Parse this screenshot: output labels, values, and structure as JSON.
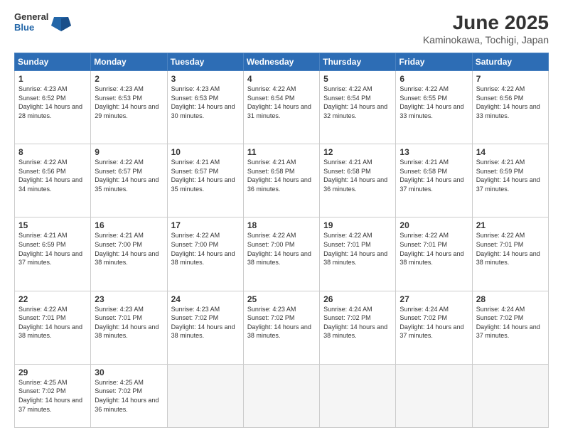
{
  "header": {
    "logo": {
      "line1": "General",
      "line2": "Blue"
    },
    "title": "June 2025",
    "location": "Kaminokawa, Tochigi, Japan"
  },
  "days_of_week": [
    "Sunday",
    "Monday",
    "Tuesday",
    "Wednesday",
    "Thursday",
    "Friday",
    "Saturday"
  ],
  "weeks": [
    [
      {
        "day": "1",
        "sunrise": "4:23 AM",
        "sunset": "6:52 PM",
        "daylight": "14 hours and 28 minutes."
      },
      {
        "day": "2",
        "sunrise": "4:23 AM",
        "sunset": "6:53 PM",
        "daylight": "14 hours and 29 minutes."
      },
      {
        "day": "3",
        "sunrise": "4:23 AM",
        "sunset": "6:53 PM",
        "daylight": "14 hours and 30 minutes."
      },
      {
        "day": "4",
        "sunrise": "4:22 AM",
        "sunset": "6:54 PM",
        "daylight": "14 hours and 31 minutes."
      },
      {
        "day": "5",
        "sunrise": "4:22 AM",
        "sunset": "6:54 PM",
        "daylight": "14 hours and 32 minutes."
      },
      {
        "day": "6",
        "sunrise": "4:22 AM",
        "sunset": "6:55 PM",
        "daylight": "14 hours and 33 minutes."
      },
      {
        "day": "7",
        "sunrise": "4:22 AM",
        "sunset": "6:56 PM",
        "daylight": "14 hours and 33 minutes."
      }
    ],
    [
      {
        "day": "8",
        "sunrise": "4:22 AM",
        "sunset": "6:56 PM",
        "daylight": "14 hours and 34 minutes."
      },
      {
        "day": "9",
        "sunrise": "4:22 AM",
        "sunset": "6:57 PM",
        "daylight": "14 hours and 35 minutes."
      },
      {
        "day": "10",
        "sunrise": "4:21 AM",
        "sunset": "6:57 PM",
        "daylight": "14 hours and 35 minutes."
      },
      {
        "day": "11",
        "sunrise": "4:21 AM",
        "sunset": "6:58 PM",
        "daylight": "14 hours and 36 minutes."
      },
      {
        "day": "12",
        "sunrise": "4:21 AM",
        "sunset": "6:58 PM",
        "daylight": "14 hours and 36 minutes."
      },
      {
        "day": "13",
        "sunrise": "4:21 AM",
        "sunset": "6:58 PM",
        "daylight": "14 hours and 37 minutes."
      },
      {
        "day": "14",
        "sunrise": "4:21 AM",
        "sunset": "6:59 PM",
        "daylight": "14 hours and 37 minutes."
      }
    ],
    [
      {
        "day": "15",
        "sunrise": "4:21 AM",
        "sunset": "6:59 PM",
        "daylight": "14 hours and 37 minutes."
      },
      {
        "day": "16",
        "sunrise": "4:21 AM",
        "sunset": "7:00 PM",
        "daylight": "14 hours and 38 minutes."
      },
      {
        "day": "17",
        "sunrise": "4:22 AM",
        "sunset": "7:00 PM",
        "daylight": "14 hours and 38 minutes."
      },
      {
        "day": "18",
        "sunrise": "4:22 AM",
        "sunset": "7:00 PM",
        "daylight": "14 hours and 38 minutes."
      },
      {
        "day": "19",
        "sunrise": "4:22 AM",
        "sunset": "7:01 PM",
        "daylight": "14 hours and 38 minutes."
      },
      {
        "day": "20",
        "sunrise": "4:22 AM",
        "sunset": "7:01 PM",
        "daylight": "14 hours and 38 minutes."
      },
      {
        "day": "21",
        "sunrise": "4:22 AM",
        "sunset": "7:01 PM",
        "daylight": "14 hours and 38 minutes."
      }
    ],
    [
      {
        "day": "22",
        "sunrise": "4:22 AM",
        "sunset": "7:01 PM",
        "daylight": "14 hours and 38 minutes."
      },
      {
        "day": "23",
        "sunrise": "4:23 AM",
        "sunset": "7:01 PM",
        "daylight": "14 hours and 38 minutes."
      },
      {
        "day": "24",
        "sunrise": "4:23 AM",
        "sunset": "7:02 PM",
        "daylight": "14 hours and 38 minutes."
      },
      {
        "day": "25",
        "sunrise": "4:23 AM",
        "sunset": "7:02 PM",
        "daylight": "14 hours and 38 minutes."
      },
      {
        "day": "26",
        "sunrise": "4:24 AM",
        "sunset": "7:02 PM",
        "daylight": "14 hours and 38 minutes."
      },
      {
        "day": "27",
        "sunrise": "4:24 AM",
        "sunset": "7:02 PM",
        "daylight": "14 hours and 37 minutes."
      },
      {
        "day": "28",
        "sunrise": "4:24 AM",
        "sunset": "7:02 PM",
        "daylight": "14 hours and 37 minutes."
      }
    ],
    [
      {
        "day": "29",
        "sunrise": "4:25 AM",
        "sunset": "7:02 PM",
        "daylight": "14 hours and 37 minutes."
      },
      {
        "day": "30",
        "sunrise": "4:25 AM",
        "sunset": "7:02 PM",
        "daylight": "14 hours and 36 minutes."
      },
      null,
      null,
      null,
      null,
      null
    ]
  ]
}
